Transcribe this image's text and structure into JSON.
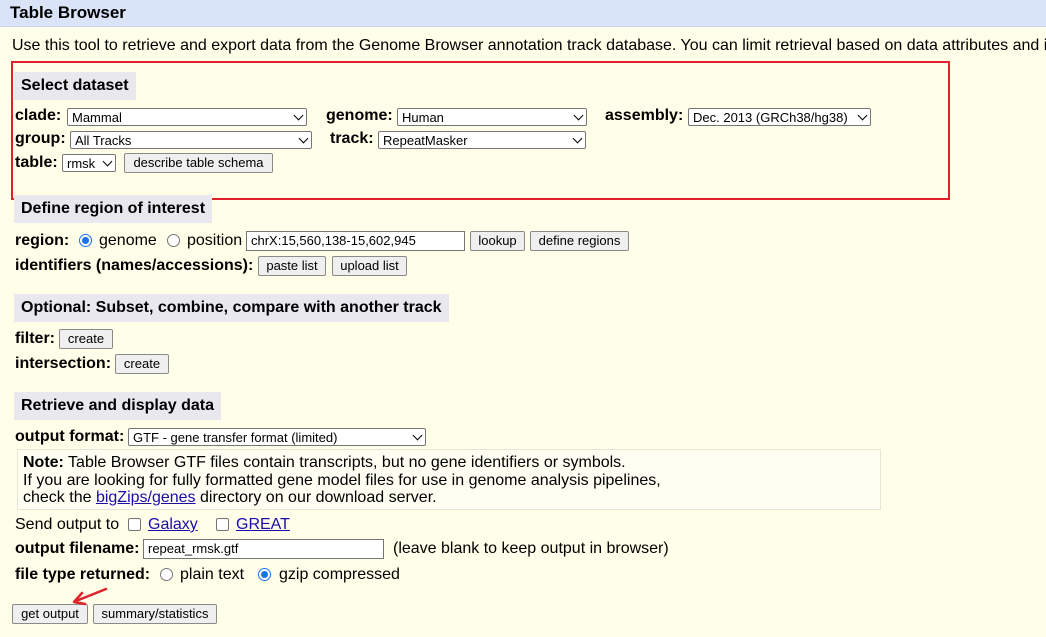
{
  "window": {
    "title": "Table Browser"
  },
  "intro": "Use this tool to retrieve and export data from the Genome Browser annotation track database. You can limit retrieval based on data attributes and i",
  "select_dataset": {
    "heading": "Select dataset",
    "clade_label": "clade:",
    "clade_value": "Mammal",
    "genome_label": "genome:",
    "genome_value": "Human",
    "assembly_label": "assembly:",
    "assembly_value": "Dec. 2013 (GRCh38/hg38)",
    "group_label": "group:",
    "group_value": "All Tracks",
    "track_label": "track:",
    "track_value": "RepeatMasker",
    "table_label": "table:",
    "table_value": "rmsk",
    "describe_button": "describe table schema"
  },
  "region": {
    "heading": "Define region of interest",
    "region_label": "region:",
    "genome_option": "genome",
    "position_option": "position",
    "position_value": "chrX:15,560,138-15,602,945",
    "lookup_button": "lookup",
    "define_regions_button": "define regions",
    "identifiers_label": "identifiers (names/accessions):",
    "paste_list_button": "paste list",
    "upload_list_button": "upload list"
  },
  "optional": {
    "heading": "Optional: Subset, combine, compare with another track",
    "filter_label": "filter:",
    "filter_button": "create",
    "intersection_label": "intersection:",
    "intersection_button": "create"
  },
  "retrieve": {
    "heading": "Retrieve and display data",
    "output_format_label": "output format:",
    "output_format_value": "GTF - gene transfer format (limited)",
    "note_label": "Note:",
    "note_line1": " Table Browser GTF files contain transcripts, but no gene identifiers or symbols.",
    "note_line2": "If you are looking for fully formatted gene model files for use in genome analysis pipelines,",
    "note_line3_pre": "check the ",
    "note_link": "bigZips/genes",
    "note_line3_post": " directory on our download server.",
    "send_output_label": "Send output to",
    "galaxy_link": "Galaxy",
    "great_link": "GREAT",
    "filename_label": "output filename:",
    "filename_value": "repeat_rmsk.gtf",
    "filename_hint": "(leave blank to keep output in browser)",
    "filetype_label": "file type returned:",
    "plain_text_option": "plain text",
    "gzip_option": "gzip compressed",
    "get_output_button": "get output",
    "summary_button": "summary/statistics"
  },
  "colors": {
    "highlight_box": "#e0212b",
    "arrow": "#e0212b",
    "title_bar": "#d9e4f8",
    "page_bg": "#fffee8"
  }
}
